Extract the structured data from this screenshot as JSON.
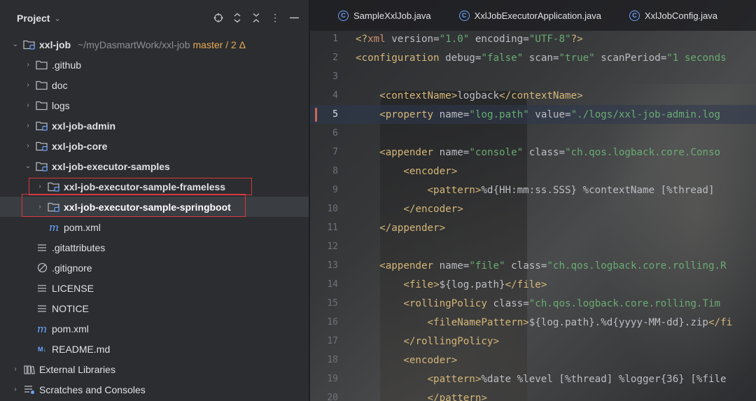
{
  "project_panel": {
    "title": "Project",
    "tree": [
      {
        "label": "xxl-job",
        "path": "~/myDasmartWork/xxl-job",
        "branch": "master / 2 Δ",
        "icon": "module-folder-icon",
        "chevron": "down"
      },
      {
        "label": ".github",
        "icon": "folder-icon",
        "chevron": "right"
      },
      {
        "label": "doc",
        "icon": "folder-icon",
        "chevron": "right"
      },
      {
        "label": "logs",
        "icon": "folder-icon",
        "chevron": "right"
      },
      {
        "label": "xxl-job-admin",
        "icon": "module-folder-icon",
        "chevron": "right",
        "bold": true
      },
      {
        "label": "xxl-job-core",
        "icon": "module-folder-icon",
        "chevron": "right",
        "bold": true
      },
      {
        "label": "xxl-job-executor-samples",
        "icon": "module-folder-icon",
        "chevron": "down",
        "bold": true
      },
      {
        "label": "xxl-job-executor-sample-frameless",
        "icon": "module-folder-icon",
        "chevron": "right",
        "bold": true,
        "highlighted": true
      },
      {
        "label": "xxl-job-executor-sample-springboot",
        "icon": "module-folder-icon",
        "chevron": "right",
        "bold": true,
        "highlighted": true,
        "selected": true
      },
      {
        "label": "pom.xml",
        "icon": "maven-icon"
      },
      {
        "label": ".gitattributes",
        "icon": "text-file-icon"
      },
      {
        "label": ".gitignore",
        "icon": "ignore-file-icon"
      },
      {
        "label": "LICENSE",
        "icon": "text-file-icon"
      },
      {
        "label": "NOTICE",
        "icon": "text-file-icon"
      },
      {
        "label": "pom.xml",
        "icon": "maven-icon"
      },
      {
        "label": "README.md",
        "icon": "markdown-icon"
      },
      {
        "label": "External Libraries",
        "icon": "library-icon",
        "chevron": "right"
      },
      {
        "label": "Scratches and Consoles",
        "icon": "scratches-icon",
        "chevron": "right"
      }
    ]
  },
  "editor": {
    "tabs": [
      {
        "label": "SampleXxlJob.java",
        "icon": "java-class-icon"
      },
      {
        "label": "XxlJobExecutorApplication.java",
        "icon": "java-class-icon"
      },
      {
        "label": "XxlJobConfig.java",
        "icon": "java-class-icon"
      }
    ],
    "current_line": 5,
    "lines": [
      {
        "n": "1",
        "code": "<?xml version=\"1.0\" encoding=\"UTF-8\"?>"
      },
      {
        "n": "2",
        "code": "<configuration debug=\"false\" scan=\"true\" scanPeriod=\"1 seconds"
      },
      {
        "n": "3",
        "code": ""
      },
      {
        "n": "4",
        "code": "    <contextName>logback</contextName>"
      },
      {
        "n": "5",
        "code": "    <property name=\"log.path\" value=\"./logs/xxl-job-admin.log"
      },
      {
        "n": "6",
        "code": ""
      },
      {
        "n": "7",
        "code": "    <appender name=\"console\" class=\"ch.qos.logback.core.Conso"
      },
      {
        "n": "8",
        "code": "        <encoder>"
      },
      {
        "n": "9",
        "code": "            <pattern>%d{HH:mm:ss.SSS} %contextName [%thread]"
      },
      {
        "n": "10",
        "code": "        </encoder>"
      },
      {
        "n": "11",
        "code": "    </appender>"
      },
      {
        "n": "12",
        "code": ""
      },
      {
        "n": "13",
        "code": "    <appender name=\"file\" class=\"ch.qos.logback.core.rolling.R"
      },
      {
        "n": "14",
        "code": "        <file>${log.path}</file>"
      },
      {
        "n": "15",
        "code": "        <rollingPolicy class=\"ch.qos.logback.core.rolling.Tim"
      },
      {
        "n": "16",
        "code": "            <fileNamePattern>${log.path}.%d{yyyy-MM-dd}.zip</fi"
      },
      {
        "n": "17",
        "code": "        </rollingPolicy>"
      },
      {
        "n": "18",
        "code": "        <encoder>"
      },
      {
        "n": "19",
        "code": "            <pattern>%date %level [%thread] %logger{36} [%file"
      },
      {
        "n": "20",
        "code": "            </pattern>"
      }
    ]
  }
}
